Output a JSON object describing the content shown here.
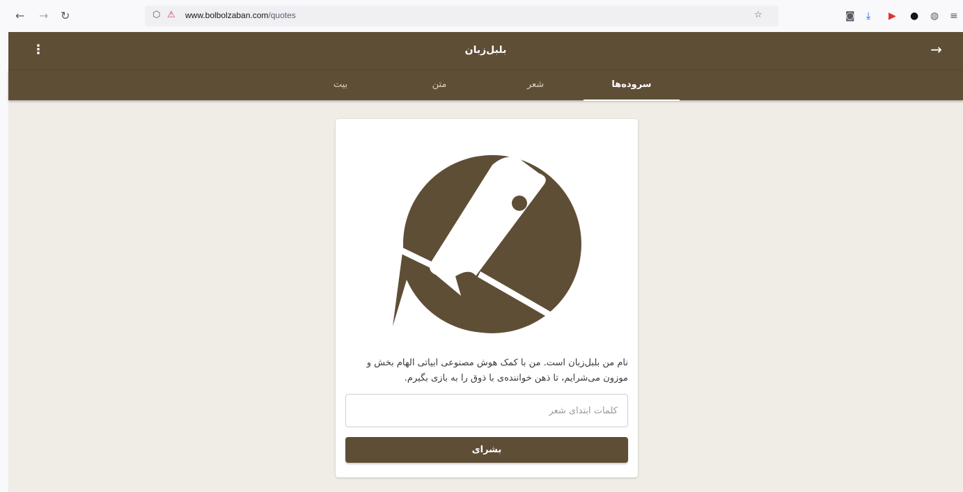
{
  "browser": {
    "url_host": "www.bolbolzaban.com",
    "url_path": "/quotes",
    "icons": [
      "back-icon",
      "forward-icon",
      "reload-icon",
      "shield-icon",
      "lock-icon",
      "star-icon",
      "pocket-icon",
      "download-icon",
      "extension-icon",
      "extension-icon",
      "globe-icon",
      "menu-icon"
    ]
  },
  "app": {
    "title": "بلبل‌زبان",
    "menu_icon": "⋮",
    "forward_icon": "→"
  },
  "tabs": [
    {
      "label": "سروده‌ها",
      "active": true
    },
    {
      "label": "شعر",
      "active": false
    },
    {
      "label": "متن",
      "active": false
    },
    {
      "label": "بیت",
      "active": false
    }
  ],
  "main": {
    "intro": "نام من بلبل‌زبان است. من با کمک هوش مصنوعی ابیاتی الهام بخش و موزون می‌شرایم، تا ذهن خواننده‌ی با ذوق را به بازی بگیرم.",
    "input_placeholder": "کلمات ابتدای شعر",
    "input_value": "",
    "submit_label": "بشرای"
  },
  "colors": {
    "brand": "#5f4e36",
    "background": "#f0ede6"
  }
}
